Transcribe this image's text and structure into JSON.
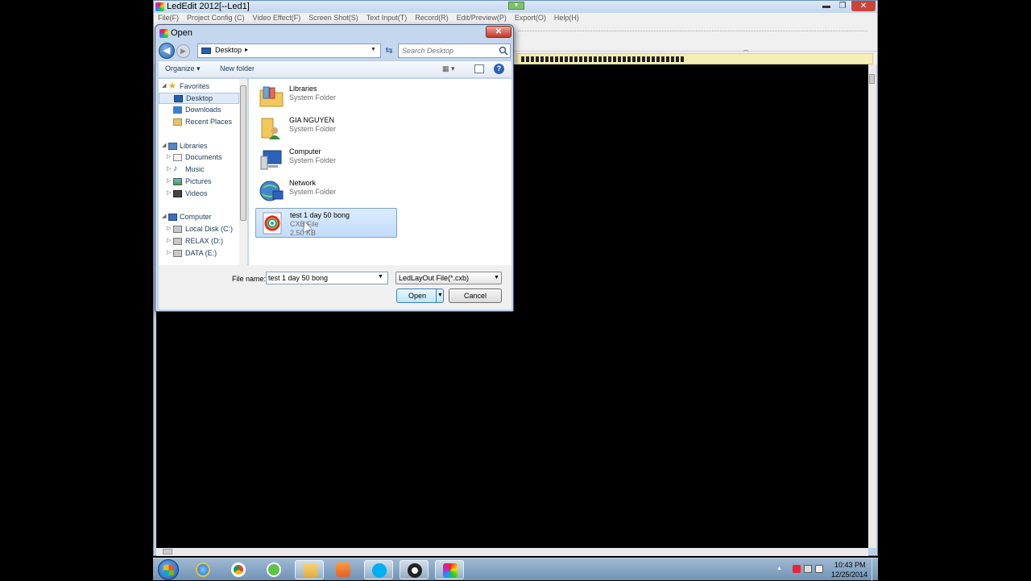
{
  "app": {
    "title": "LedEdit 2012[--Led1]",
    "menu": [
      "File(F)",
      "Project Config (C)",
      "Video Effect(F)",
      "Screen Shot(S)",
      "Text Input(T)",
      "Record(R)",
      "Edit/Preview(P)",
      "Export(O)",
      "Help(H)"
    ],
    "window_controls": {
      "minimize": "▬",
      "maximize": "❐",
      "close": "✕"
    }
  },
  "dialog": {
    "title": "Open",
    "close_label": "✕",
    "address": {
      "location": "Desktop",
      "separator": "▸"
    },
    "search": {
      "placeholder": "Search Desktop"
    },
    "toolbar": {
      "organize": "Organize ▾",
      "new_folder": "New folder",
      "views": "▦ ▾",
      "help": "?"
    },
    "nav": {
      "favorites": {
        "label": "Favorites",
        "items": [
          "Desktop",
          "Downloads",
          "Recent Places"
        ]
      },
      "libraries": {
        "label": "Libraries",
        "items": [
          "Documents",
          "Music",
          "Pictures",
          "Videos"
        ]
      },
      "computer": {
        "label": "Computer",
        "items": [
          "Local Disk (C:)",
          "RELAX (D:)",
          "DATA (E:)"
        ]
      }
    },
    "files": [
      {
        "name": "Libraries",
        "type": "System Folder",
        "size": "",
        "icon": "libraries-folder-icon"
      },
      {
        "name": "GIA NGUYEN",
        "type": "System Folder",
        "size": "",
        "icon": "user-folder-icon"
      },
      {
        "name": "Computer",
        "type": "System Folder",
        "size": "",
        "icon": "computer-icon"
      },
      {
        "name": "Network",
        "type": "System Folder",
        "size": "",
        "icon": "network-icon"
      },
      {
        "name": "test 1 day 50 bong",
        "type": "CXB File",
        "size": "2.50 KB",
        "icon": "cxb-file-icon"
      }
    ],
    "file_name_label": "File name:",
    "file_name_value": "test 1 day 50 bong",
    "file_type": "LedLayOut File(*.cxb)",
    "open_label": "Open",
    "cancel_label": "Cancel"
  },
  "taskbar": {
    "time": "10:43 PM",
    "date": "12/25/2014"
  },
  "colors": {
    "accent": "#3c7fb1",
    "taskbar": "#7193b5",
    "selection": "#c1dcfc"
  }
}
